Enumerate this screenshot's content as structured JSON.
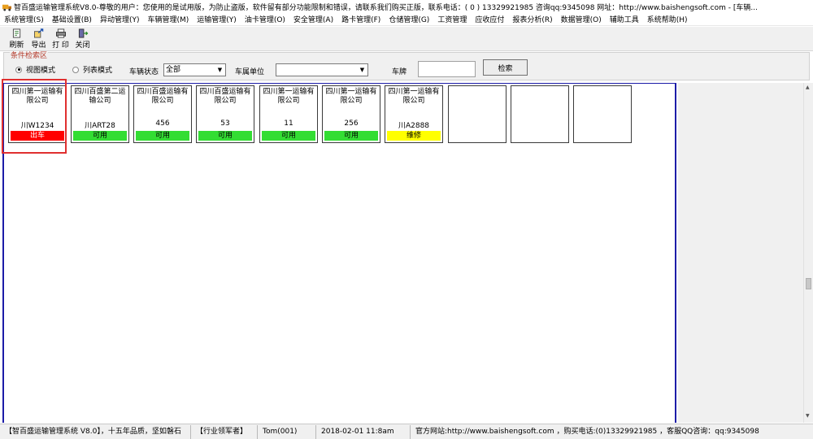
{
  "window": {
    "title": "智百盛运输管理系统V8.0-尊敬的用户：您使用的是试用版，为防止盗版，软件留有部分功能限制和错误，请联系我们购买正版，联系电话：( 0 ) 13329921985  咨询qq:9345098   网址：http://www.baishengsoft.com - [车辆..."
  },
  "menu": [
    "系统管理(S)",
    "基础设置(B)",
    "异动管理(Y)",
    "车辆管理(M)",
    "运输管理(Y)",
    "油卡管理(O)",
    "安全管理(A)",
    "路卡管理(F)",
    "仓储管理(G)",
    "工资管理",
    "应收应付",
    "报表分析(R)",
    "数据管理(O)",
    "辅助工具",
    "系统帮助(H)"
  ],
  "toolbar": {
    "refresh": "刷新",
    "export": "导出",
    "print": "打 印",
    "close": "关闭"
  },
  "filter": {
    "legend": "条件检索区",
    "view_mode": "视图模式",
    "list_mode": "列表模式",
    "vehicle_status_label": "车辆状态",
    "vehicle_status_value": "全部",
    "owner_unit_label": "车属单位",
    "owner_unit_value": "",
    "plate_label": "车牌",
    "search_button": "检索"
  },
  "vehicles": [
    {
      "company_line1": "四川第一运输有",
      "company_line2": "限公司",
      "plate": "川W1234",
      "status": "出车"
    },
    {
      "company_line1": "四川百盛第二运",
      "company_line2": "输公司",
      "plate": "川ART28",
      "status": "可用"
    },
    {
      "company_line1": "四川百盛运输有",
      "company_line2": "限公司",
      "plate": "456",
      "status": "可用"
    },
    {
      "company_line1": "四川百盛运输有",
      "company_line2": "限公司",
      "plate": "53",
      "status": "可用"
    },
    {
      "company_line1": "四川第一运输有",
      "company_line2": "限公司",
      "plate": "11",
      "status": "可用"
    },
    {
      "company_line1": "四川第一运输有",
      "company_line2": "限公司",
      "plate": "256",
      "status": "可用"
    },
    {
      "company_line1": "四川第一运输有",
      "company_line2": "限公司",
      "plate": "川A2888",
      "status": "维修"
    }
  ],
  "statusbar": {
    "app": "【智百盛运输管理系统 V8.0】，十五年品质，坚如磐石",
    "leader": "【行业领军者】",
    "user": "Tom(001)",
    "datetime": "2018-02-01 11:8am",
    "contact": "官方网站:http://www.baishengsoft.com ，购买电话:(0)13329921985 ，客服QQ咨询：qq:9345098"
  },
  "colors": {
    "status_out": "#ff0000",
    "status_available": "#33dd33",
    "status_repair": "#ffff00",
    "content_border": "#1c1ca8",
    "highlight": "#e03030"
  }
}
